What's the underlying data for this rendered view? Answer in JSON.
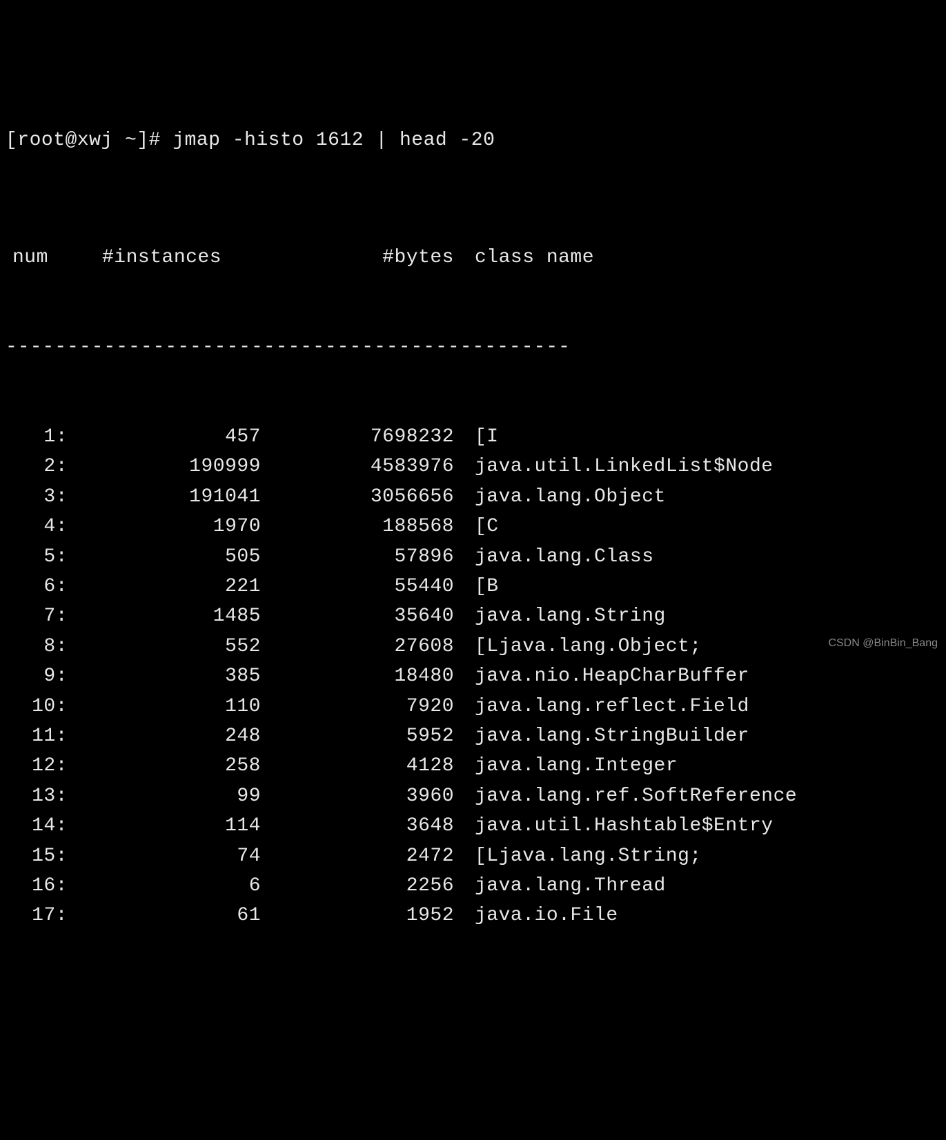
{
  "prompt": "[root@xwj ~]# jmap -histo 1612 | head -20",
  "header": {
    "num": "num",
    "instances": "#instances",
    "bytes": "#bytes",
    "class_name": "class name"
  },
  "divider": "----------------------------------------------",
  "rows": [
    {
      "num": "1:",
      "instances": "457",
      "bytes": "7698232",
      "class_name": "[I"
    },
    {
      "num": "2:",
      "instances": "190999",
      "bytes": "4583976",
      "class_name": "java.util.LinkedList$Node"
    },
    {
      "num": "3:",
      "instances": "191041",
      "bytes": "3056656",
      "class_name": "java.lang.Object"
    },
    {
      "num": "4:",
      "instances": "1970",
      "bytes": "188568",
      "class_name": "[C"
    },
    {
      "num": "5:",
      "instances": "505",
      "bytes": "57896",
      "class_name": "java.lang.Class"
    },
    {
      "num": "6:",
      "instances": "221",
      "bytes": "55440",
      "class_name": "[B"
    },
    {
      "num": "7:",
      "instances": "1485",
      "bytes": "35640",
      "class_name": "java.lang.String"
    },
    {
      "num": "8:",
      "instances": "552",
      "bytes": "27608",
      "class_name": "[Ljava.lang.Object;"
    },
    {
      "num": "9:",
      "instances": "385",
      "bytes": "18480",
      "class_name": "java.nio.HeapCharBuffer"
    },
    {
      "num": "10:",
      "instances": "110",
      "bytes": "7920",
      "class_name": "java.lang.reflect.Field"
    },
    {
      "num": "11:",
      "instances": "248",
      "bytes": "5952",
      "class_name": "java.lang.StringBuilder"
    },
    {
      "num": "12:",
      "instances": "258",
      "bytes": "4128",
      "class_name": "java.lang.Integer"
    },
    {
      "num": "13:",
      "instances": "99",
      "bytes": "3960",
      "class_name": "java.lang.ref.SoftReference"
    },
    {
      "num": "14:",
      "instances": "114",
      "bytes": "3648",
      "class_name": "java.util.Hashtable$Entry"
    },
    {
      "num": "15:",
      "instances": "74",
      "bytes": "2472",
      "class_name": "[Ljava.lang.String;"
    },
    {
      "num": "16:",
      "instances": "6",
      "bytes": "2256",
      "class_name": "java.lang.Thread"
    },
    {
      "num": "17:",
      "instances": "61",
      "bytes": "1952",
      "class_name": "java.io.File"
    }
  ],
  "watermark": "CSDN @BinBin_Bang"
}
